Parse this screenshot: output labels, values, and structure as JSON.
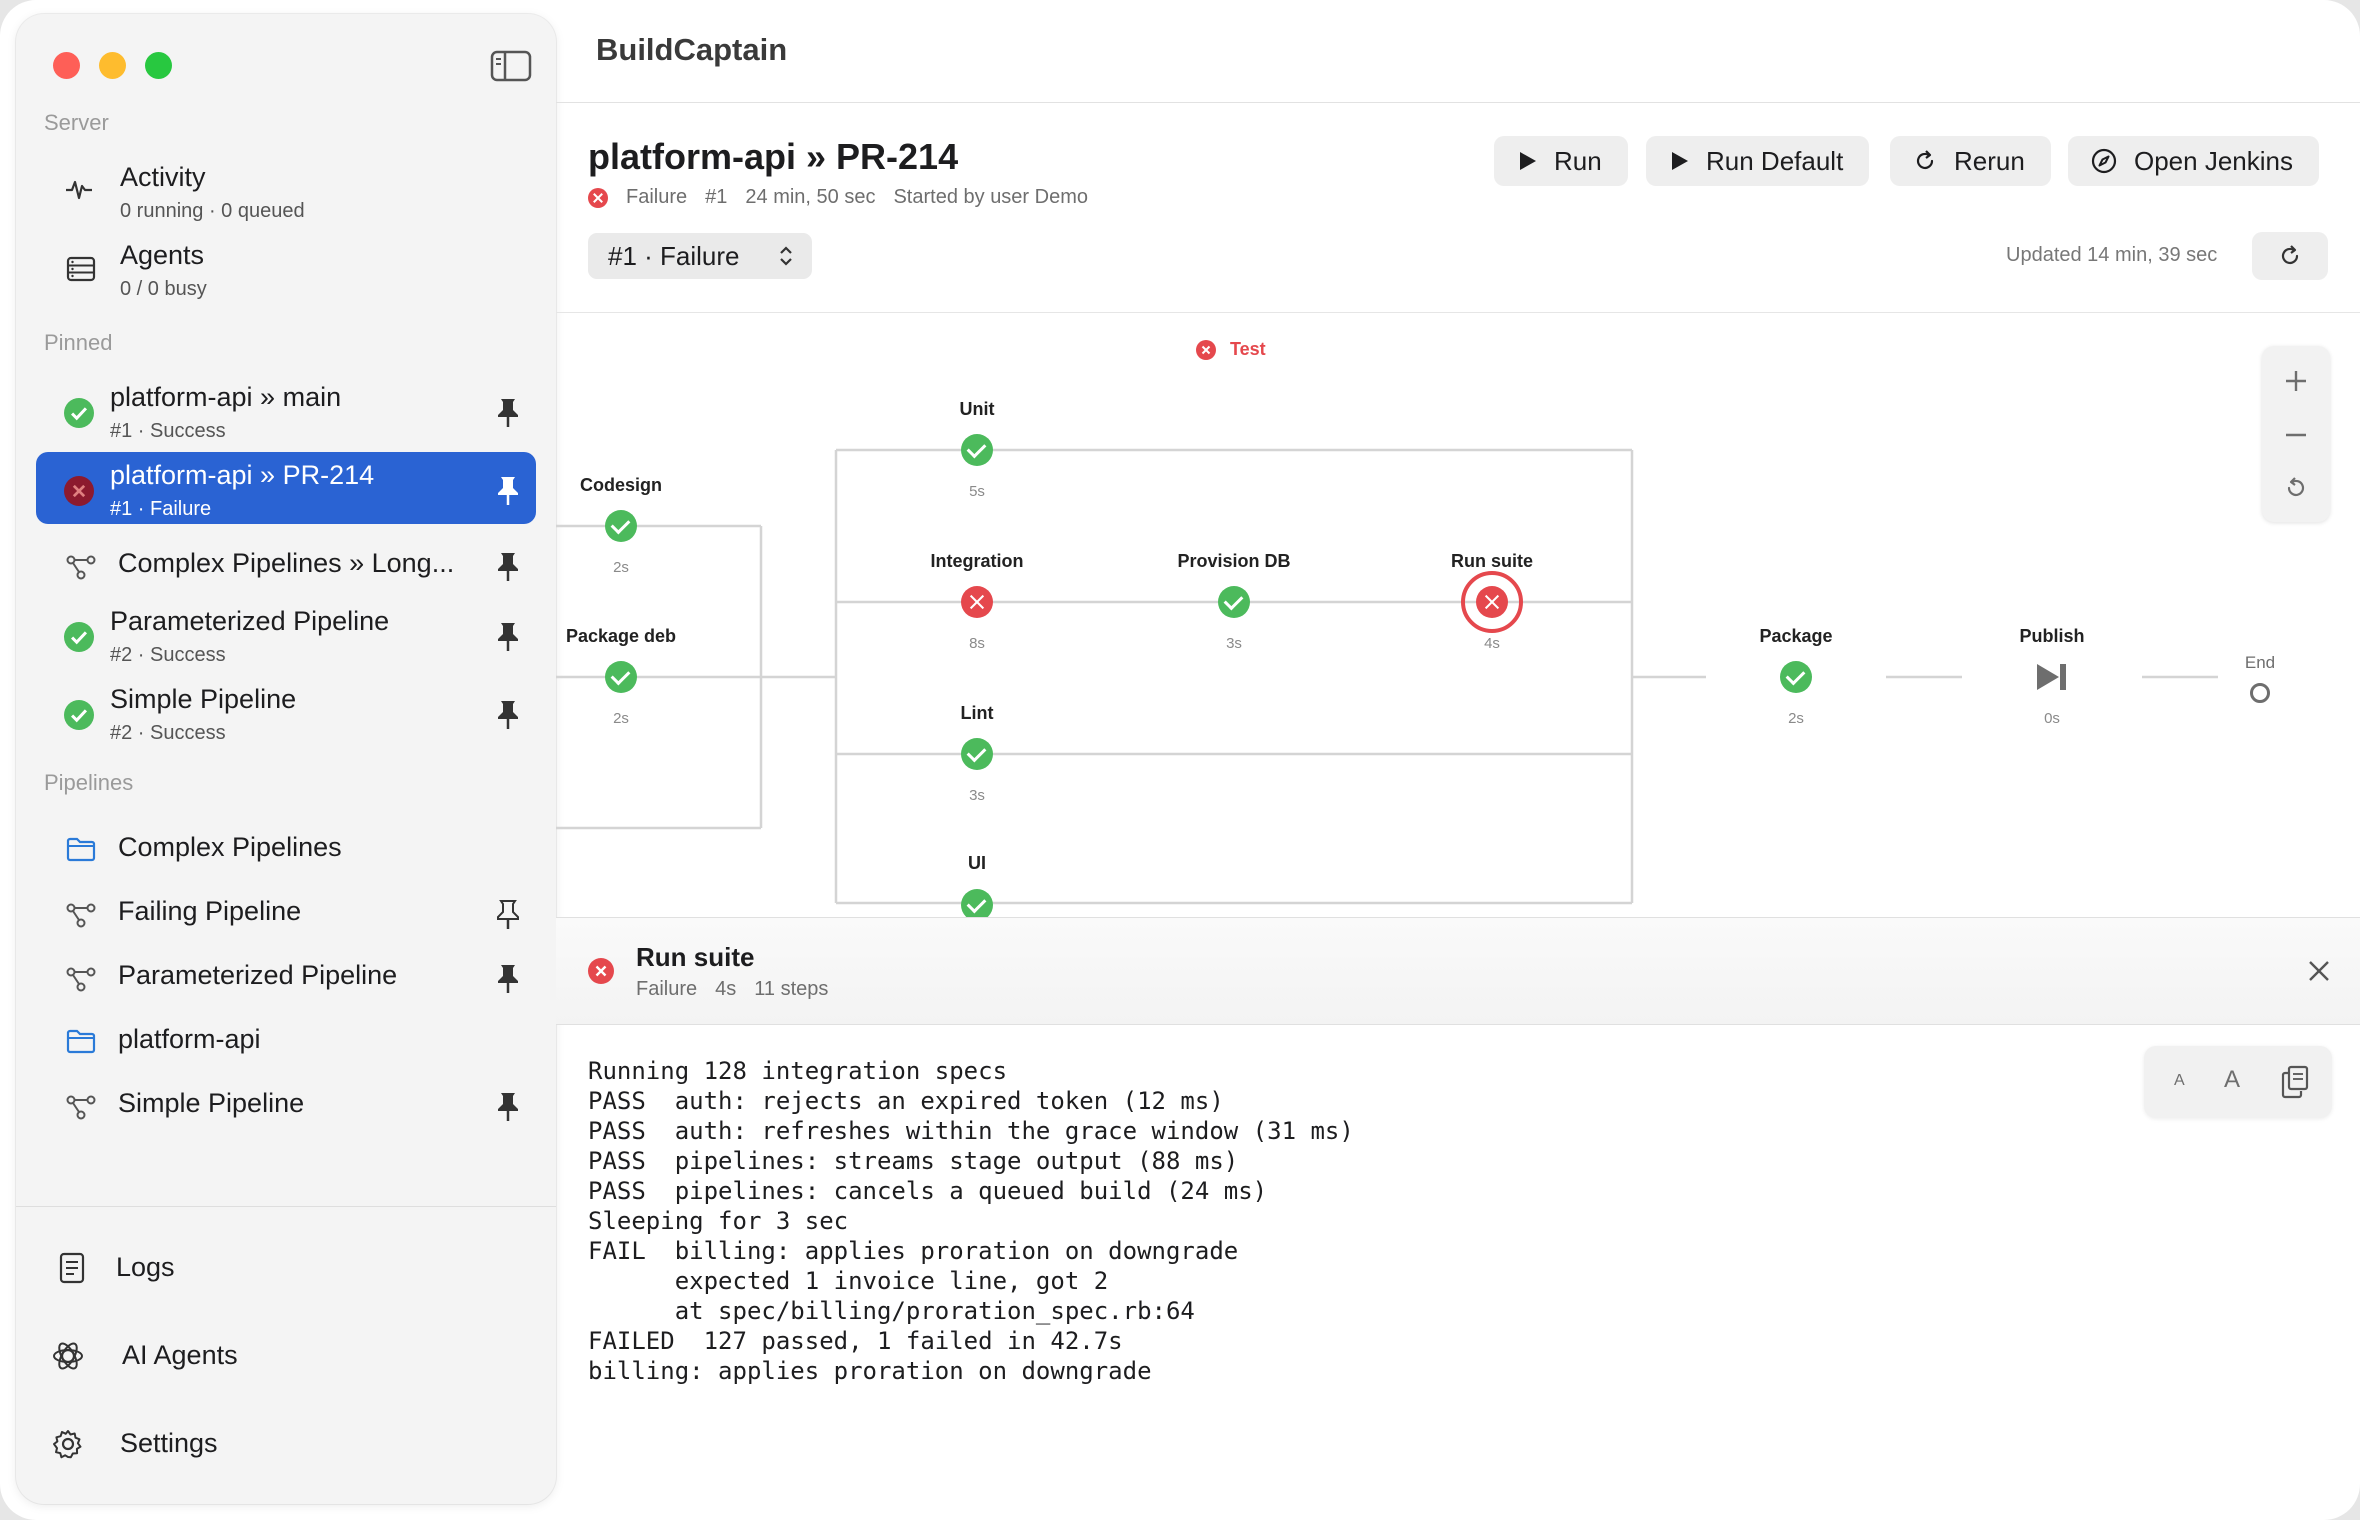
{
  "app": {
    "title": "BuildCaptain"
  },
  "sidebar": {
    "sections": {
      "server": "Server",
      "pinned": "Pinned",
      "pipelines": "Pipelines"
    },
    "server_items": [
      {
        "title": "Activity",
        "subtitle": "0 running · 0 queued",
        "icon": "activity-icon"
      },
      {
        "title": "Agents",
        "subtitle": "0 / 0 busy",
        "icon": "agents-icon"
      }
    ],
    "pinned_items": [
      {
        "title": "platform-api » main",
        "subtitle": "#1 · Success",
        "status": "success"
      },
      {
        "title": "platform-api » PR-214",
        "subtitle": "#1 · Failure",
        "status": "failure",
        "selected": true
      },
      {
        "title": "Complex Pipelines » Long...",
        "status": "pipeline"
      },
      {
        "title": "Parameterized Pipeline",
        "subtitle": "#2 · Success",
        "status": "success"
      },
      {
        "title": "Simple Pipeline",
        "subtitle": "#2 · Success",
        "status": "success"
      }
    ],
    "pipeline_items": [
      {
        "title": "Complex Pipelines",
        "type": "folder"
      },
      {
        "title": "Failing Pipeline",
        "type": "pipeline",
        "pinned": false
      },
      {
        "title": "Parameterized Pipeline",
        "type": "pipeline",
        "pinned": true
      },
      {
        "title": "platform-api",
        "type": "folder"
      },
      {
        "title": "Simple Pipeline",
        "type": "pipeline",
        "pinned": true
      }
    ],
    "footer": [
      {
        "title": "Logs",
        "icon": "logs-icon"
      },
      {
        "title": "AI Agents",
        "icon": "ai-agents-icon"
      },
      {
        "title": "Settings",
        "icon": "gear-icon"
      }
    ]
  },
  "header": {
    "title": "platform-api » PR-214",
    "status": "Failure",
    "build": "#1",
    "duration": "24 min, 50 sec",
    "started_by": "Started by user Demo",
    "run_select": "#1 · Failure",
    "updated": "Updated 14 min, 39 sec",
    "buttons": {
      "run": "Run",
      "run_default": "Run Default",
      "rerun": "Rerun",
      "open_jenkins": "Open Jenkins"
    }
  },
  "graph": {
    "group_label": "Test",
    "nodes": [
      {
        "label": "Codesign",
        "duration": "2s",
        "status": "success"
      },
      {
        "label": "Package deb",
        "duration": "2s",
        "status": "success"
      },
      {
        "label": "Unit",
        "duration": "5s",
        "status": "success"
      },
      {
        "label": "Integration",
        "duration": "8s",
        "status": "failure"
      },
      {
        "label": "Provision DB",
        "duration": "3s",
        "status": "success"
      },
      {
        "label": "Run suite",
        "duration": "4s",
        "status": "failure",
        "selected": true
      },
      {
        "label": "Lint",
        "duration": "3s",
        "status": "success"
      },
      {
        "label": "UI",
        "duration": "",
        "status": "success"
      },
      {
        "label": "Package",
        "duration": "2s",
        "status": "success"
      },
      {
        "label": "Publish",
        "duration": "0s",
        "status": "skipped"
      },
      {
        "label": "End",
        "duration": "",
        "status": "end"
      }
    ]
  },
  "detail": {
    "title": "Run suite",
    "status": "Failure",
    "duration": "4s",
    "steps": "11 steps",
    "log": [
      "Running 128 integration specs",
      "PASS  auth: rejects an expired token (12 ms)",
      "PASS  auth: refreshes within the grace window (31 ms)",
      "PASS  pipelines: streams stage output (88 ms)",
      "PASS  pipelines: cancels a queued build (24 ms)",
      "Sleeping for 3 sec",
      "FAIL  billing: applies proration on downgrade",
      "      expected 1 invoice line, got 2",
      "      at spec/billing/proration_spec.rb:64",
      "FAILED  127 passed, 1 failed in 42.7s",
      "billing: applies proration on downgrade"
    ],
    "tools": {
      "font_small": "A",
      "font_large": "A"
    }
  },
  "colors": {
    "accent": "#2a63d3",
    "success": "#4cba5c",
    "failure": "#e5484d"
  }
}
